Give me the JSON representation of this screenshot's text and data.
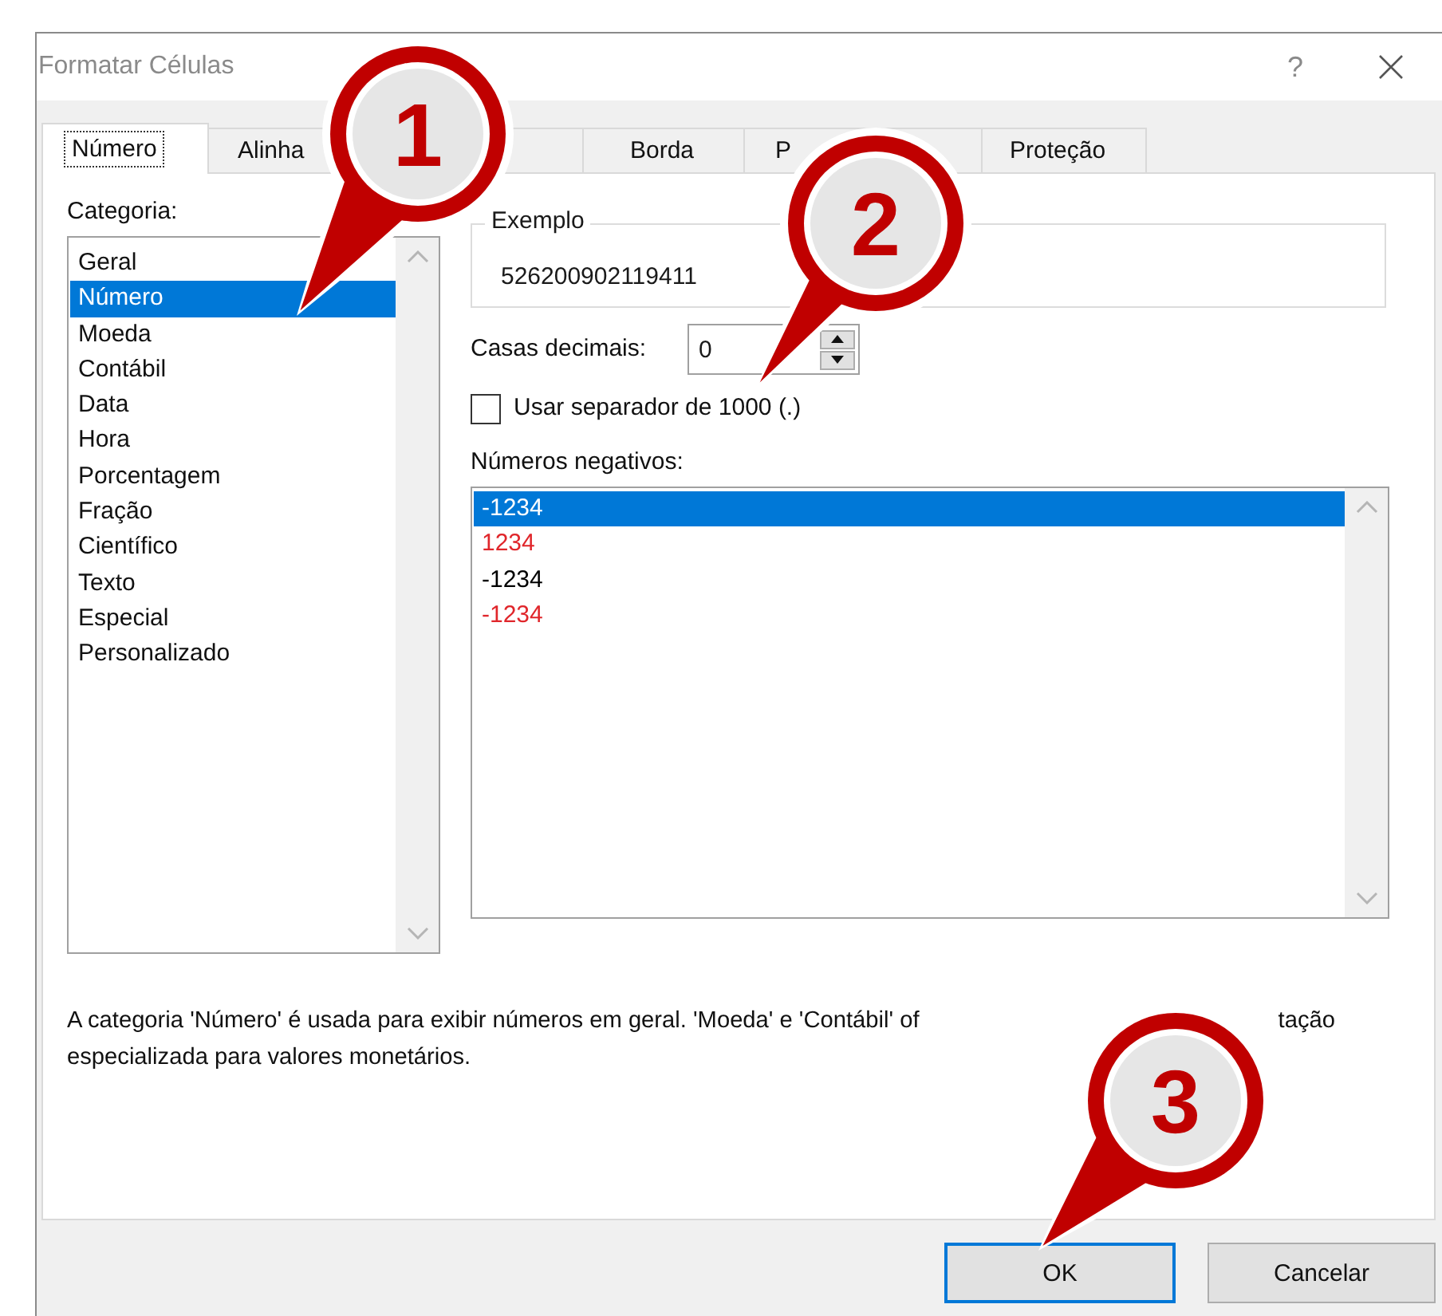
{
  "window": {
    "title": "Formatar Células",
    "help": "?"
  },
  "tabs": [
    {
      "label": "Número",
      "selected": true
    },
    {
      "label": "Alinha",
      "selected": false
    },
    {
      "selected": false
    },
    {
      "label": "Borda",
      "selected": false
    },
    {
      "label": "P",
      "selected": false
    },
    {
      "label": "Proteção",
      "selected": false
    }
  ],
  "category": {
    "label": "Categoria:",
    "items": [
      {
        "label": "Geral",
        "selected": false
      },
      {
        "label": "Número",
        "selected": true
      },
      {
        "label": "Moeda",
        "selected": false
      },
      {
        "label": "Contábil",
        "selected": false
      },
      {
        "label": "Data",
        "selected": false
      },
      {
        "label": "Hora",
        "selected": false
      },
      {
        "label": "Porcentagem",
        "selected": false
      },
      {
        "label": "Fração",
        "selected": false
      },
      {
        "label": "Científico",
        "selected": false
      },
      {
        "label": "Texto",
        "selected": false
      },
      {
        "label": "Especial",
        "selected": false
      },
      {
        "label": "Personalizado",
        "selected": false
      }
    ]
  },
  "sample": {
    "label": "Exemplo",
    "value": "526200902119411"
  },
  "decimal_places": {
    "label": "Casas decimais:",
    "value": "0"
  },
  "thousands_separator": {
    "label": "Usar separador de 1000 (.)",
    "checked": false
  },
  "negative_numbers": {
    "label": "Números negativos:",
    "items": [
      {
        "label": "-1234",
        "selected": true
      },
      {
        "label": "1234",
        "color": "#e0262b",
        "selected": false
      },
      {
        "label": "-1234",
        "color": "#000000",
        "selected": false
      },
      {
        "label": "-1234",
        "color": "#e0262b",
        "selected": false
      }
    ]
  },
  "description": {
    "line_1_start": "A categoria 'Número' é usada para exibir números em geral. 'Moeda' e 'Contábil' of",
    "line_1_end": "tação",
    "line_2": "especializada para valores monetários."
  },
  "buttons": [
    {
      "label": "OK",
      "default": true
    },
    {
      "label": "Cancelar",
      "default": false
    }
  ],
  "callouts": [
    {
      "number": "1"
    },
    {
      "number": "2"
    },
    {
      "number": "3"
    }
  ]
}
